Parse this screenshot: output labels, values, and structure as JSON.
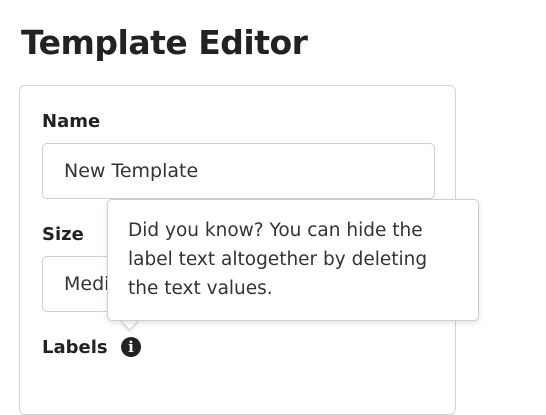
{
  "page": {
    "title": "Template Editor"
  },
  "form": {
    "name_label": "Name",
    "name_value": "New Template",
    "size_label": "Size",
    "size_value": "Medium",
    "labels_label": "Labels",
    "info_icon_glyph": "i"
  },
  "tooltip": {
    "text": "Did you know? You can hide the label text altogether by deleting the text values."
  },
  "icons": {
    "info": "info-icon"
  }
}
